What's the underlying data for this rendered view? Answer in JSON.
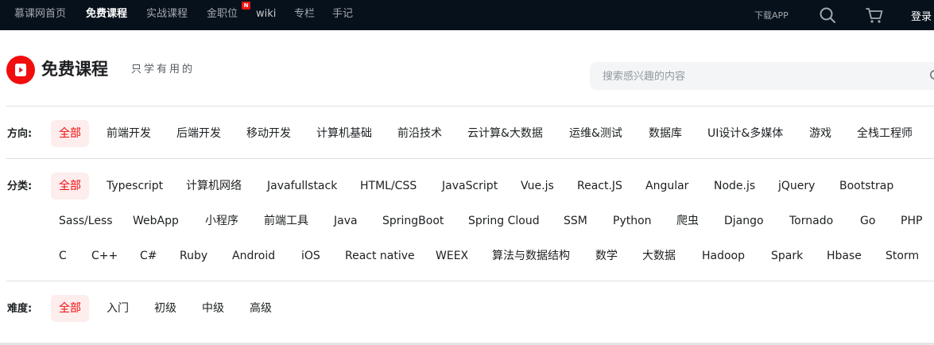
{
  "topnav": {
    "items": [
      {
        "label": "慕课网首页",
        "active": false
      },
      {
        "label": "免费课程",
        "active": true
      },
      {
        "label": "实战课程",
        "active": false
      },
      {
        "label": "金职位",
        "active": false
      },
      {
        "label": "wiki",
        "active": false
      },
      {
        "label": "专栏",
        "active": false
      },
      {
        "label": "手记",
        "active": false
      }
    ],
    "new_badge": "N",
    "download_app": "下载APP",
    "login": "登录"
  },
  "heading": {
    "title": "免费课程",
    "subtitle": "只学有用的"
  },
  "search": {
    "placeholder": "搜索感兴趣的内容",
    "value": ""
  },
  "filters": {
    "direction": {
      "label": "方向:",
      "options": [
        "全部",
        "前端开发",
        "后端开发",
        "移动开发",
        "计算机基础",
        "前沿技术",
        "云计算&大数据",
        "运维&测试",
        "数据库",
        "UI设计&多媒体",
        "游戏",
        "全栈工程师"
      ],
      "selected": "全部"
    },
    "category": {
      "label": "分类:",
      "options": [
        "全部",
        "Typescript",
        "计算机网络",
        "Javafullstack",
        "HTML/CSS",
        "JavaScript",
        "Vue.js",
        "React.JS",
        "Angular",
        "Node.js",
        "jQuery",
        "Bootstrap",
        "Sass/Less",
        "WebApp",
        "小程序",
        "前端工具",
        "Java",
        "SpringBoot",
        "Spring Cloud",
        "SSM",
        "Python",
        "爬虫",
        "Django",
        "Tornado",
        "Go",
        "PHP",
        "C",
        "C++",
        "C#",
        "Ruby",
        "Android",
        "iOS",
        "React native",
        "WEEX",
        "算法与数据结构",
        "数学",
        "大数据",
        "Hadoop",
        "Spark",
        "Hbase",
        "Storm"
      ],
      "selected": "全部"
    },
    "difficulty": {
      "label": "难度:",
      "options": [
        "全部",
        "入门",
        "初级",
        "中级",
        "高级"
      ],
      "selected": "全部"
    }
  },
  "colors": {
    "accent": "#f20d0d",
    "active_bg": "#fdeded",
    "topbar_bg": "#07111b"
  },
  "icons": {
    "logo": "play-book-icon",
    "search": "search-icon",
    "cart": "cart-icon"
  }
}
